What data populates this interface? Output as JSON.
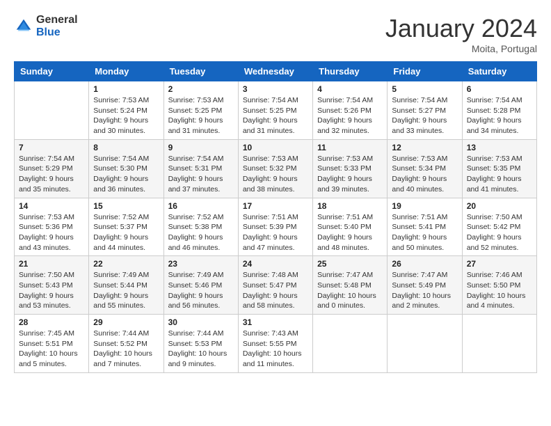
{
  "header": {
    "logo": {
      "general": "General",
      "blue": "Blue"
    },
    "title": "January 2024",
    "location": "Moita, Portugal"
  },
  "days_of_week": [
    "Sunday",
    "Monday",
    "Tuesday",
    "Wednesday",
    "Thursday",
    "Friday",
    "Saturday"
  ],
  "weeks": [
    [
      {
        "day": "",
        "sunrise": "",
        "sunset": "",
        "daylight": ""
      },
      {
        "day": "1",
        "sunrise": "Sunrise: 7:53 AM",
        "sunset": "Sunset: 5:24 PM",
        "daylight": "Daylight: 9 hours and 30 minutes."
      },
      {
        "day": "2",
        "sunrise": "Sunrise: 7:53 AM",
        "sunset": "Sunset: 5:25 PM",
        "daylight": "Daylight: 9 hours and 31 minutes."
      },
      {
        "day": "3",
        "sunrise": "Sunrise: 7:54 AM",
        "sunset": "Sunset: 5:25 PM",
        "daylight": "Daylight: 9 hours and 31 minutes."
      },
      {
        "day": "4",
        "sunrise": "Sunrise: 7:54 AM",
        "sunset": "Sunset: 5:26 PM",
        "daylight": "Daylight: 9 hours and 32 minutes."
      },
      {
        "day": "5",
        "sunrise": "Sunrise: 7:54 AM",
        "sunset": "Sunset: 5:27 PM",
        "daylight": "Daylight: 9 hours and 33 minutes."
      },
      {
        "day": "6",
        "sunrise": "Sunrise: 7:54 AM",
        "sunset": "Sunset: 5:28 PM",
        "daylight": "Daylight: 9 hours and 34 minutes."
      }
    ],
    [
      {
        "day": "7",
        "sunrise": "Sunrise: 7:54 AM",
        "sunset": "Sunset: 5:29 PM",
        "daylight": "Daylight: 9 hours and 35 minutes."
      },
      {
        "day": "8",
        "sunrise": "Sunrise: 7:54 AM",
        "sunset": "Sunset: 5:30 PM",
        "daylight": "Daylight: 9 hours and 36 minutes."
      },
      {
        "day": "9",
        "sunrise": "Sunrise: 7:54 AM",
        "sunset": "Sunset: 5:31 PM",
        "daylight": "Daylight: 9 hours and 37 minutes."
      },
      {
        "day": "10",
        "sunrise": "Sunrise: 7:53 AM",
        "sunset": "Sunset: 5:32 PM",
        "daylight": "Daylight: 9 hours and 38 minutes."
      },
      {
        "day": "11",
        "sunrise": "Sunrise: 7:53 AM",
        "sunset": "Sunset: 5:33 PM",
        "daylight": "Daylight: 9 hours and 39 minutes."
      },
      {
        "day": "12",
        "sunrise": "Sunrise: 7:53 AM",
        "sunset": "Sunset: 5:34 PM",
        "daylight": "Daylight: 9 hours and 40 minutes."
      },
      {
        "day": "13",
        "sunrise": "Sunrise: 7:53 AM",
        "sunset": "Sunset: 5:35 PM",
        "daylight": "Daylight: 9 hours and 41 minutes."
      }
    ],
    [
      {
        "day": "14",
        "sunrise": "Sunrise: 7:53 AM",
        "sunset": "Sunset: 5:36 PM",
        "daylight": "Daylight: 9 hours and 43 minutes."
      },
      {
        "day": "15",
        "sunrise": "Sunrise: 7:52 AM",
        "sunset": "Sunset: 5:37 PM",
        "daylight": "Daylight: 9 hours and 44 minutes."
      },
      {
        "day": "16",
        "sunrise": "Sunrise: 7:52 AM",
        "sunset": "Sunset: 5:38 PM",
        "daylight": "Daylight: 9 hours and 46 minutes."
      },
      {
        "day": "17",
        "sunrise": "Sunrise: 7:51 AM",
        "sunset": "Sunset: 5:39 PM",
        "daylight": "Daylight: 9 hours and 47 minutes."
      },
      {
        "day": "18",
        "sunrise": "Sunrise: 7:51 AM",
        "sunset": "Sunset: 5:40 PM",
        "daylight": "Daylight: 9 hours and 48 minutes."
      },
      {
        "day": "19",
        "sunrise": "Sunrise: 7:51 AM",
        "sunset": "Sunset: 5:41 PM",
        "daylight": "Daylight: 9 hours and 50 minutes."
      },
      {
        "day": "20",
        "sunrise": "Sunrise: 7:50 AM",
        "sunset": "Sunset: 5:42 PM",
        "daylight": "Daylight: 9 hours and 52 minutes."
      }
    ],
    [
      {
        "day": "21",
        "sunrise": "Sunrise: 7:50 AM",
        "sunset": "Sunset: 5:43 PM",
        "daylight": "Daylight: 9 hours and 53 minutes."
      },
      {
        "day": "22",
        "sunrise": "Sunrise: 7:49 AM",
        "sunset": "Sunset: 5:44 PM",
        "daylight": "Daylight: 9 hours and 55 minutes."
      },
      {
        "day": "23",
        "sunrise": "Sunrise: 7:49 AM",
        "sunset": "Sunset: 5:46 PM",
        "daylight": "Daylight: 9 hours and 56 minutes."
      },
      {
        "day": "24",
        "sunrise": "Sunrise: 7:48 AM",
        "sunset": "Sunset: 5:47 PM",
        "daylight": "Daylight: 9 hours and 58 minutes."
      },
      {
        "day": "25",
        "sunrise": "Sunrise: 7:47 AM",
        "sunset": "Sunset: 5:48 PM",
        "daylight": "Daylight: 10 hours and 0 minutes."
      },
      {
        "day": "26",
        "sunrise": "Sunrise: 7:47 AM",
        "sunset": "Sunset: 5:49 PM",
        "daylight": "Daylight: 10 hours and 2 minutes."
      },
      {
        "day": "27",
        "sunrise": "Sunrise: 7:46 AM",
        "sunset": "Sunset: 5:50 PM",
        "daylight": "Daylight: 10 hours and 4 minutes."
      }
    ],
    [
      {
        "day": "28",
        "sunrise": "Sunrise: 7:45 AM",
        "sunset": "Sunset: 5:51 PM",
        "daylight": "Daylight: 10 hours and 5 minutes."
      },
      {
        "day": "29",
        "sunrise": "Sunrise: 7:44 AM",
        "sunset": "Sunset: 5:52 PM",
        "daylight": "Daylight: 10 hours and 7 minutes."
      },
      {
        "day": "30",
        "sunrise": "Sunrise: 7:44 AM",
        "sunset": "Sunset: 5:53 PM",
        "daylight": "Daylight: 10 hours and 9 minutes."
      },
      {
        "day": "31",
        "sunrise": "Sunrise: 7:43 AM",
        "sunset": "Sunset: 5:55 PM",
        "daylight": "Daylight: 10 hours and 11 minutes."
      },
      {
        "day": "",
        "sunrise": "",
        "sunset": "",
        "daylight": ""
      },
      {
        "day": "",
        "sunrise": "",
        "sunset": "",
        "daylight": ""
      },
      {
        "day": "",
        "sunrise": "",
        "sunset": "",
        "daylight": ""
      }
    ]
  ]
}
